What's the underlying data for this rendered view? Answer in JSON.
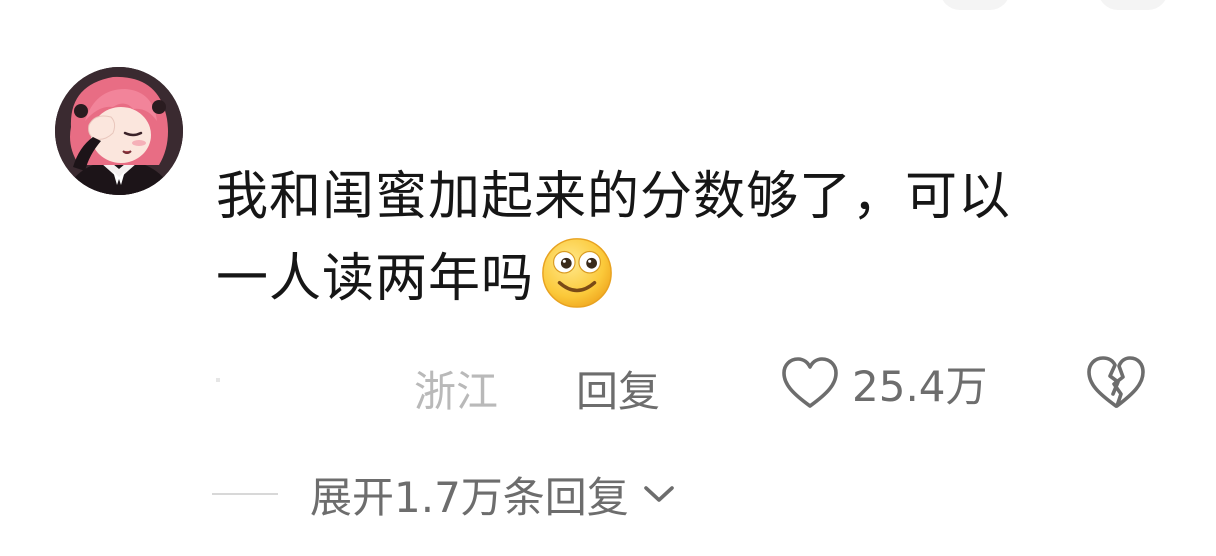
{
  "comment": {
    "text_line1": "我和闺蜜加起来的分数够了，可以",
    "text_line2": "一人读两年吗",
    "emoji": "smiling-face-emoji",
    "location": "浙江",
    "reply_label": "回复",
    "like_count": "25.4万",
    "expand_replies_label": "展开1.7万条回复"
  },
  "icons": {
    "avatar": "anime-girl-avatar",
    "like": "heart-outline-icon",
    "dislike": "broken-heart-icon",
    "expand": "chevron-down-icon"
  },
  "colors": {
    "text_primary": "#161616",
    "text_secondary": "#6d6d6d",
    "text_muted": "#b9b9b9",
    "avatar_hair": "#f0788c"
  }
}
